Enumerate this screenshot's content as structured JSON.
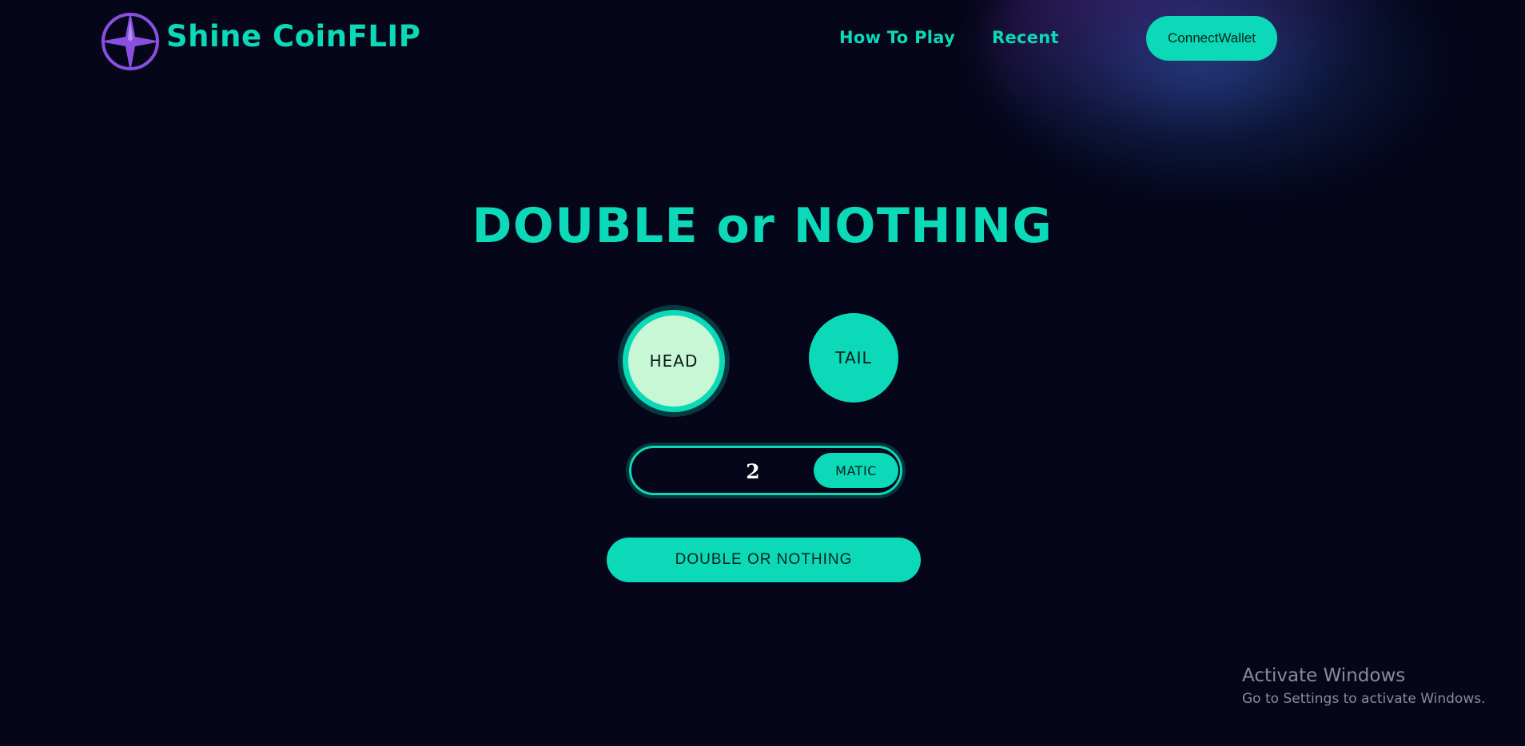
{
  "header": {
    "brand": "Shine CoinFLIP",
    "nav": {
      "how_to_play": "How To Play",
      "recent": "Recent"
    },
    "connect_wallet": "ConnectWallet"
  },
  "main": {
    "title": "DOUBLE or NOTHING",
    "choices": {
      "head": "HEAD",
      "tail": "TAIL",
      "selected": "HEAD"
    },
    "amount": {
      "value": "2",
      "currency": "MATIC"
    },
    "submit_label": "DOUBLE OR NOTHING"
  },
  "watermark": {
    "title": "Activate Windows",
    "subtitle": "Go to Settings to activate Windows."
  },
  "colors": {
    "background": "#05061a",
    "accent": "#0bd9b7",
    "selected_fill": "#c8f7d6",
    "logo": "#8a4fe0"
  },
  "icons": {
    "logo": "four-point-star-compass-icon"
  }
}
